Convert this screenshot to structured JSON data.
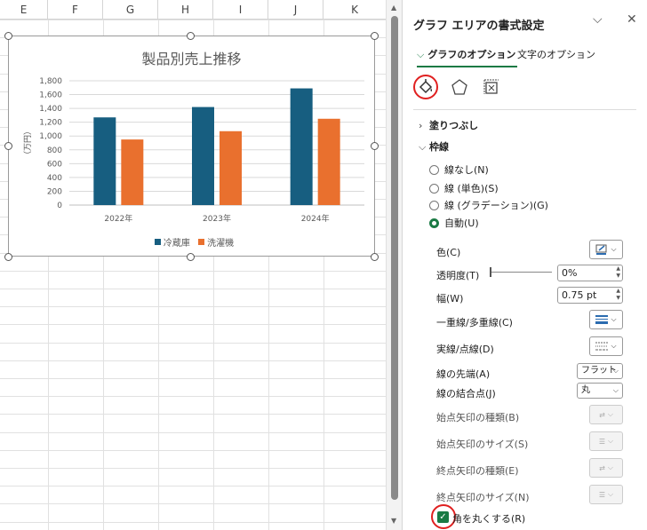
{
  "sheet": {
    "columns": [
      "E",
      "F",
      "G",
      "H",
      "I",
      "J",
      "K"
    ]
  },
  "chart_data": {
    "type": "bar",
    "title": "製品別売上推移",
    "ylabel": "（万円）",
    "categories": [
      "2022年",
      "2023年",
      "2024年"
    ],
    "series": [
      {
        "name": "冷蔵庫",
        "values": [
          1270,
          1420,
          1690
        ],
        "color": "#175e80"
      },
      {
        "name": "洗濯機",
        "values": [
          950,
          1070,
          1250
        ],
        "color": "#e9702e"
      }
    ],
    "yticks": [
      "0",
      "200",
      "400",
      "600",
      "800",
      "1,000",
      "1,200",
      "1,400",
      "1,600",
      "1,800"
    ],
    "ylim": [
      0,
      1800
    ],
    "grid": true,
    "legend": "bottom"
  },
  "pane": {
    "title": "グラフ エリアの書式設定",
    "tabs": [
      "グラフのオプション",
      "文字のオプション"
    ],
    "sections": {
      "fill": "塗りつぶし",
      "border": "枠線"
    },
    "border_options": [
      "線なし(N)",
      "線 (単色)(S)",
      "線 (グラデーション)(G)",
      "自動(U)"
    ],
    "labels": {
      "color": "色(C)",
      "transparency": "透明度(T)",
      "width": "幅(W)",
      "compound": "一重線/多重線(C)",
      "dash": "実線/点線(D)",
      "cap": "線の先端(A)",
      "join": "線の結合点(J)",
      "begin_arrow_type": "始点矢印の種類(B)",
      "begin_arrow_size": "始点矢印のサイズ(S)",
      "end_arrow_type": "終点矢印の種類(E)",
      "end_arrow_size": "終点矢印のサイズ(N)",
      "rounded": "角を丸くする(R)"
    },
    "values": {
      "transparency": "0%",
      "width": "0.75 pt",
      "cap": "フラット",
      "join": "丸"
    },
    "transparency_level": 0,
    "rounded_checked": true,
    "accent": "#1a7a44"
  }
}
